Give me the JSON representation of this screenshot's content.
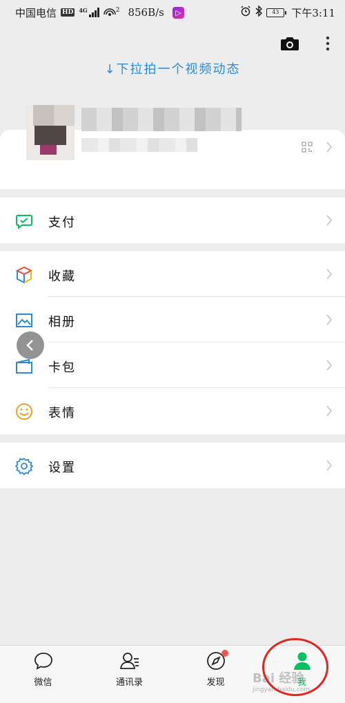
{
  "status_bar": {
    "carrier": "中国电信",
    "hd_badge": "HD",
    "network": "4G",
    "hotspot_level": "2",
    "speed": "856B/s",
    "battery": "43",
    "time": "下午3:11"
  },
  "header": {
    "pull_hint": "↓下拉拍一个视频动态"
  },
  "menu": {
    "pay": {
      "label": "支付",
      "icon": "wechat-pay-icon"
    },
    "favorites": {
      "label": "收藏",
      "icon": "favorites-cube-icon"
    },
    "album": {
      "label": "相册",
      "icon": "album-icon"
    },
    "cards": {
      "label": "卡包",
      "icon": "card-wallet-icon"
    },
    "stickers": {
      "label": "表情",
      "icon": "smiley-icon"
    },
    "settings": {
      "label": "设置",
      "icon": "gear-icon"
    }
  },
  "bottom_nav": [
    {
      "label": "微信",
      "icon": "chat-bubble-icon",
      "active": false
    },
    {
      "label": "通讯录",
      "icon": "contacts-icon",
      "active": false
    },
    {
      "label": "发现",
      "icon": "compass-icon",
      "active": false,
      "badge": true
    },
    {
      "label": "我",
      "icon": "person-icon",
      "active": true
    }
  ],
  "watermark": {
    "text": "Bai 经验",
    "sub": "jingyan.baidu.com"
  },
  "colors": {
    "accent_green": "#07c160",
    "hint_blue": "#2d8ad6",
    "badge_red": "#fa5151",
    "annotation_red": "#e0261f"
  }
}
